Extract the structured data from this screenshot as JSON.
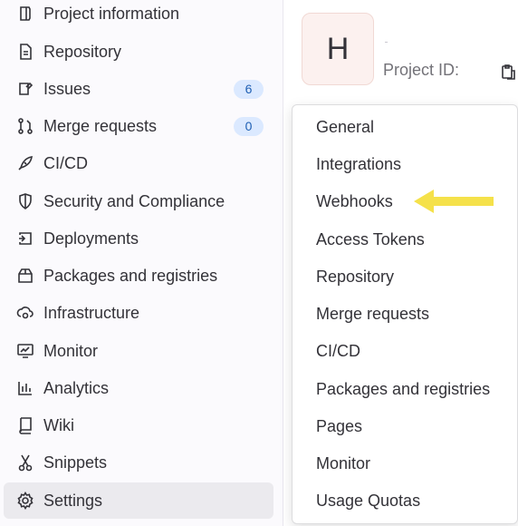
{
  "sidebar": {
    "items": [
      {
        "label": "Project information",
        "icon": "project-info-icon"
      },
      {
        "label": "Repository",
        "icon": "document-icon"
      },
      {
        "label": "Issues",
        "icon": "issues-icon",
        "badge": "6"
      },
      {
        "label": "Merge requests",
        "icon": "merge-request-icon",
        "badge": "0"
      },
      {
        "label": "CI/CD",
        "icon": "rocket-icon"
      },
      {
        "label": "Security and Compliance",
        "icon": "shield-icon"
      },
      {
        "label": "Deployments",
        "icon": "deployments-icon"
      },
      {
        "label": "Packages and registries",
        "icon": "package-icon"
      },
      {
        "label": "Infrastructure",
        "icon": "cloud-gear-icon"
      },
      {
        "label": "Monitor",
        "icon": "monitor-icon"
      },
      {
        "label": "Analytics",
        "icon": "chart-icon"
      },
      {
        "label": "Wiki",
        "icon": "book-icon"
      },
      {
        "label": "Snippets",
        "icon": "scissors-icon"
      },
      {
        "label": "Settings",
        "icon": "gear-icon",
        "active": true
      }
    ]
  },
  "project": {
    "avatar_letter": "H",
    "id_label": "Project ID:"
  },
  "settings_menu": {
    "items": [
      "General",
      "Integrations",
      "Webhooks",
      "Access Tokens",
      "Repository",
      "Merge requests",
      "CI/CD",
      "Packages and registries",
      "Pages",
      "Monitor",
      "Usage Quotas"
    ],
    "highlighted": "Webhooks"
  },
  "colors": {
    "badge_bg": "#dbe9ff",
    "badge_text": "#1f5fb4",
    "active_bg": "#ebeaee",
    "arrow": "#f5e14a",
    "avatar_bg": "#fcf1ef"
  }
}
